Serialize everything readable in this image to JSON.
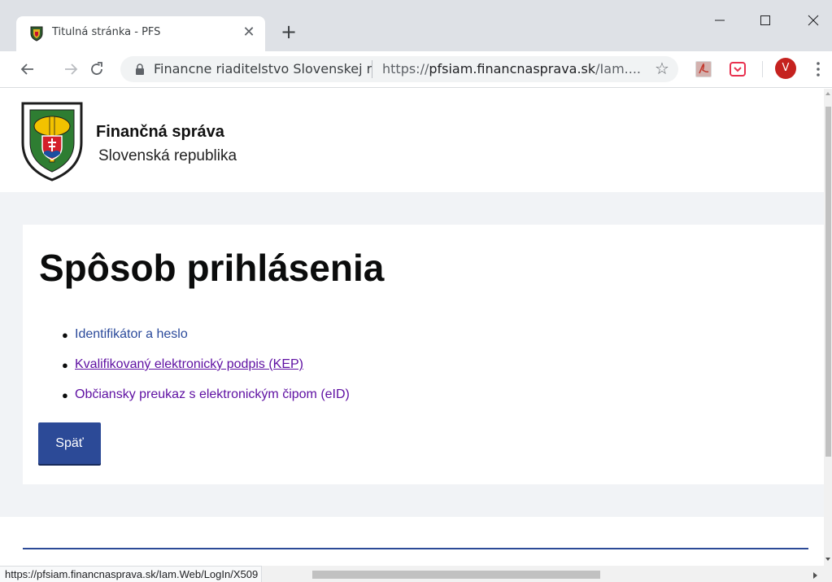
{
  "browser": {
    "tab": {
      "title": "Titulná stránka - PFS",
      "close_glyph": "✕"
    },
    "new_tab_glyph": "+",
    "omnibox": {
      "organization": "Financne riaditelstvo Slovenskej r",
      "url_scheme": "https://",
      "url_host": "pfsiam.financnasprava.sk",
      "url_path": "/Iam...."
    },
    "star_glyph": "☆",
    "avatar_letter": "V",
    "status_url": "https://pfsiam.financnasprava.sk/Iam.Web/LogIn/X509"
  },
  "site": {
    "org_name": "Finančná správa",
    "org_country": "Slovenská republika"
  },
  "page": {
    "title": "Spôsob prihlásenia",
    "methods": [
      {
        "label": "Identifikátor a heslo"
      },
      {
        "label": "Kvalifikovaný elektronický podpis (KEP)"
      },
      {
        "label": "Občiansky preukaz s elektronickým čipom (eID)"
      }
    ],
    "back_label": "Späť"
  },
  "colors": {
    "primary_button": "#2c4a97",
    "link": "#2b4a9b",
    "visited_link": "#5e0fa2",
    "page_background": "#f1f3f6"
  },
  "icons": {
    "favicon": "coat-of-arms-icon",
    "emblem": "financna-sprava-emblem-icon",
    "lock": "lock-icon",
    "star": "star-icon",
    "pdf_extension": "pdf-extension-icon",
    "pocket_extension": "pocket-extension-icon",
    "kebab": "kebab-menu-icon"
  }
}
